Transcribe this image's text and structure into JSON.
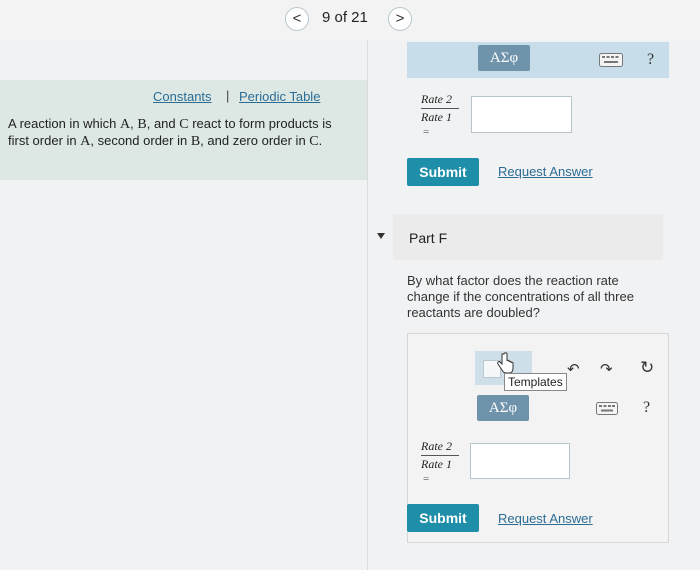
{
  "nav": {
    "prev_icon": "chevron-left-icon",
    "next_icon": "chevron-right-icon",
    "pager_text": "9 of 21",
    "prev_glyph": "<",
    "next_glyph": ">"
  },
  "left_panel": {
    "constants_label": "Constants",
    "separator": "|",
    "periodic_table_label": "Periodic Table",
    "problem_parts": [
      "A reaction in which ",
      "A",
      ", ",
      "B",
      ", and ",
      "C",
      " react to form products is first order in ",
      "A",
      ", second order in ",
      "B",
      ", and zero order in ",
      "C",
      "."
    ]
  },
  "part_e": {
    "toolbar_greek": "ΑΣφ",
    "help": "?",
    "ratio_num": "Rate 2",
    "ratio_den": "Rate 1",
    "equals": "=",
    "answer_value": "",
    "submit_label": "Submit",
    "request_answer_label": "Request Answer"
  },
  "part_f": {
    "title": "Part F",
    "question": "By what factor does the reaction rate change if the concentrations of all three reactants are doubled?",
    "templates_tooltip": "Templates",
    "undo_glyph": "↶",
    "redo_glyph": "↷",
    "reset_glyph": "↻",
    "toolbar_greek": "ΑΣφ",
    "help": "?",
    "ratio_num": "Rate 2",
    "ratio_den": "Rate 1",
    "equals": "=",
    "answer_value": "",
    "submit_label": "Submit",
    "request_answer_label": "Request Answer"
  },
  "colors": {
    "accent": "#1f8ea8",
    "link": "#2b6c95",
    "panel_bg": "#dde8e4",
    "toolbar_bg": "#c7dde9",
    "greek_bg": "#6e93ab"
  }
}
